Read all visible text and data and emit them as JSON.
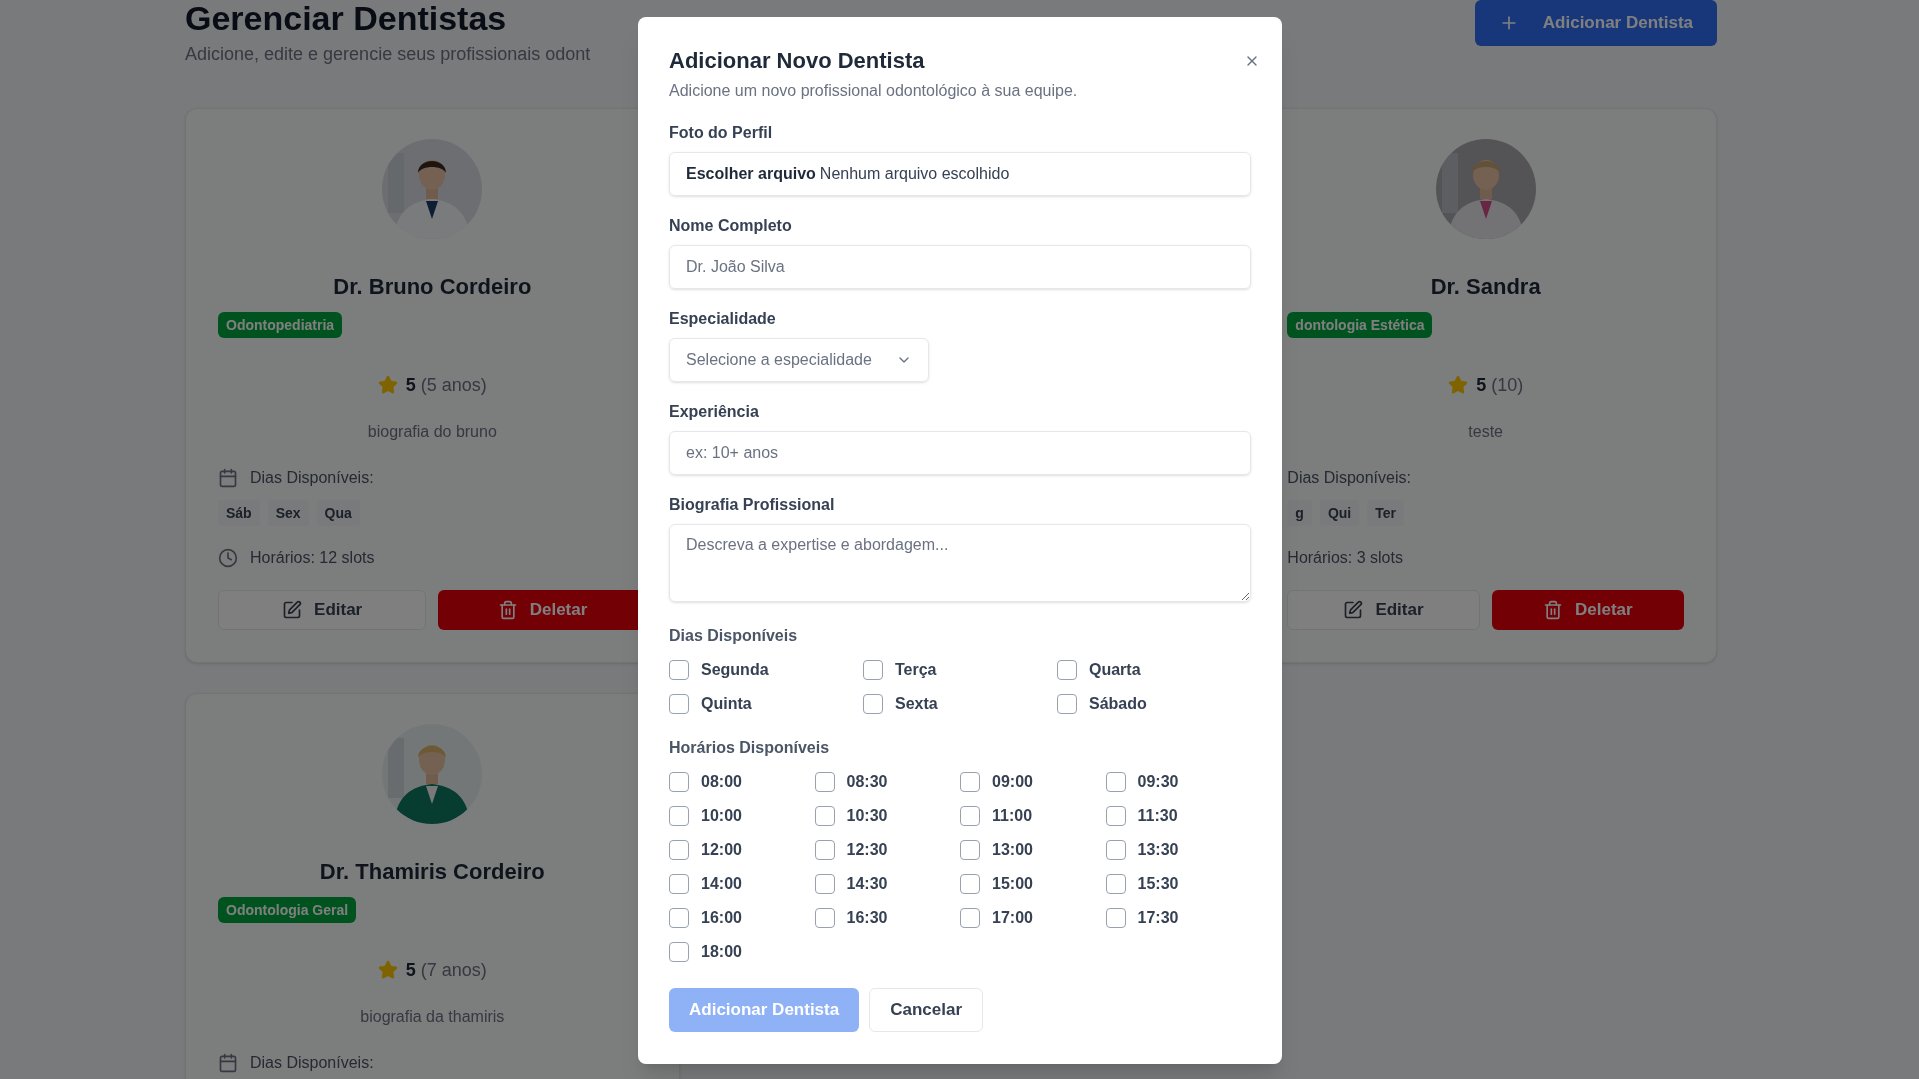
{
  "page": {
    "title": "Gerenciar Dentistas",
    "subtitle": "Adicione, edite e gerencie seus profissionais odont"
  },
  "add_button": {
    "label": "Adicionar Dentista"
  },
  "dentists": [
    {
      "kind": "full",
      "name": "Dr. Bruno Cordeiro",
      "specialty": "Odontopediatria",
      "rating": "5",
      "experience": "(5 anos)",
      "bio": "biografia do bruno",
      "days_label": "Dias Disponíveis:",
      "days": [
        "Sáb",
        "Sex",
        "Qua"
      ],
      "slots": "Horários: 12 slots",
      "edit": "Editar",
      "delete": "Deletar"
    },
    {
      "kind": "clipped",
      "name": "Dr. Sandra",
      "specialty": "dontologia Estética",
      "rating": "5",
      "experience": "(10)",
      "bio": "teste",
      "days_label": "Dias Disponíveis:",
      "days": [
        "g",
        "Qui",
        "Ter"
      ],
      "slots": "Horários: 3 slots",
      "edit": "Editar",
      "delete": "Deletar"
    },
    {
      "kind": "full",
      "name": "Dr. Thamiris Cordeiro",
      "specialty": "Odontologia Geral",
      "rating": "5",
      "experience": "(7 anos)",
      "bio": "biografia da thamiris",
      "days_label": "Dias Disponíveis:"
    }
  ],
  "dialog": {
    "title": "Adicionar Novo Dentista",
    "subtitle": "Adicione um novo profissional odontológico à sua equipe.",
    "fields": [
      {
        "kind": "file",
        "label": "Foto do Perfil",
        "button": "Escolher arquivo",
        "value": "Nenhum arquivo escolhido"
      },
      {
        "kind": "text",
        "label": "Nome Completo",
        "placeholder": "Dr. João Silva"
      },
      {
        "kind": "select",
        "label": "Especialidade",
        "placeholder": "Selecione a especialidade"
      },
      {
        "kind": "text",
        "label": "Experiência",
        "placeholder": "ex: 10+ anos"
      },
      {
        "kind": "textarea",
        "label": "Biografia Profissional",
        "placeholder": "Descreva a expertise e abordagem..."
      }
    ],
    "days": {
      "label": "Dias Disponíveis",
      "options": [
        {
          "label": "Segunda",
          "checked": false
        },
        {
          "label": "Terça",
          "checked": false
        },
        {
          "label": "Quarta",
          "checked": false
        },
        {
          "label": "Quinta",
          "checked": false
        },
        {
          "label": "Sexta",
          "checked": false
        },
        {
          "label": "Sábado",
          "checked": false
        }
      ]
    },
    "times": {
      "label": "Horários Disponíveis",
      "options": [
        {
          "label": "08:00",
          "checked": false
        },
        {
          "label": "08:30",
          "checked": false
        },
        {
          "label": "09:00",
          "checked": false
        },
        {
          "label": "09:30",
          "checked": false
        },
        {
          "label": "10:00",
          "checked": false
        },
        {
          "label": "10:30",
          "checked": false
        },
        {
          "label": "11:00",
          "checked": false
        },
        {
          "label": "11:30",
          "checked": false
        },
        {
          "label": "12:00",
          "checked": false
        },
        {
          "label": "12:30",
          "checked": false
        },
        {
          "label": "13:00",
          "checked": false
        },
        {
          "label": "13:30",
          "checked": false
        },
        {
          "label": "14:00",
          "checked": false
        },
        {
          "label": "14:30",
          "checked": false
        },
        {
          "label": "15:00",
          "checked": false
        },
        {
          "label": "15:30",
          "checked": false
        },
        {
          "label": "16:00",
          "checked": false
        },
        {
          "label": "16:30",
          "checked": false
        },
        {
          "label": "17:00",
          "checked": false
        },
        {
          "label": "17:30",
          "checked": false
        },
        {
          "label": "18:00",
          "checked": false
        }
      ]
    },
    "submit": {
      "label": "Adicionar Dentista",
      "disabled": true
    },
    "cancel": {
      "label": "Cancelar"
    }
  }
}
